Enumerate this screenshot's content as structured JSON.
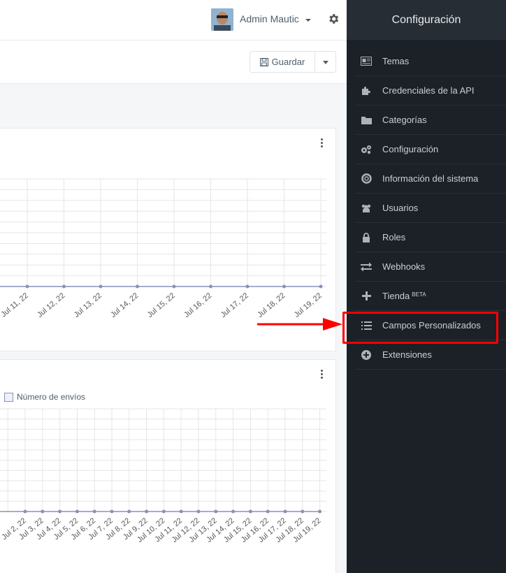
{
  "header": {
    "user_name": "Admin Mautic",
    "save_label": "Guardar"
  },
  "sidebar": {
    "title": "Configuración",
    "items": [
      {
        "label": "Temas",
        "icon": "theme-icon"
      },
      {
        "label": "Credenciales de la API",
        "icon": "puzzle-icon"
      },
      {
        "label": "Categorías",
        "icon": "folder-icon"
      },
      {
        "label": "Configuración",
        "icon": "cogs-icon"
      },
      {
        "label": "Información del sistema",
        "icon": "lifebuoy-icon"
      },
      {
        "label": "Usuarios",
        "icon": "users-icon"
      },
      {
        "label": "Roles",
        "icon": "lock-icon"
      },
      {
        "label": "Webhooks",
        "icon": "exchange-icon"
      },
      {
        "label": "Tienda",
        "badge": "BETA",
        "icon": "plus-icon"
      },
      {
        "label": "Campos Personalizados",
        "icon": "list-icon"
      },
      {
        "label": "Extensiones",
        "icon": "plus-circle-icon"
      }
    ]
  },
  "chart_data": [
    {
      "type": "line",
      "x": [
        "Jul 11, 22",
        "Jul 12, 22",
        "Jul 13, 22",
        "Jul 14, 22",
        "Jul 15, 22",
        "Jul 16, 22",
        "Jul 17, 22",
        "Jul 18, 22",
        "Jul 19, 22"
      ],
      "series": [
        {
          "values": [
            0,
            0,
            0,
            0,
            0,
            0,
            0,
            0,
            0
          ]
        }
      ],
      "grid": true,
      "colors": {
        "line": "#8b90b8"
      }
    },
    {
      "type": "line",
      "x": [
        "Jul 2, 22",
        "Jul 3, 22",
        "Jul 4, 22",
        "Jul 5, 22",
        "Jul 6, 22",
        "Jul 7, 22",
        "Jul 8, 22",
        "Jul 9, 22",
        "Jul 10, 22",
        "Jul 11, 22",
        "Jul 12, 22",
        "Jul 13, 22",
        "Jul 14, 22",
        "Jul 15, 22",
        "Jul 16, 22",
        "Jul 17, 22",
        "Jul 18, 22",
        "Jul 19, 22"
      ],
      "series": [
        {
          "name": "Número de envíos",
          "values": [
            0,
            0,
            0,
            0,
            0,
            0,
            0,
            0,
            0,
            0,
            0,
            0,
            0,
            0,
            0,
            0,
            0,
            0
          ]
        }
      ],
      "legend": "top-left",
      "grid": true,
      "colors": {
        "line": "#8b90b8"
      }
    }
  ]
}
